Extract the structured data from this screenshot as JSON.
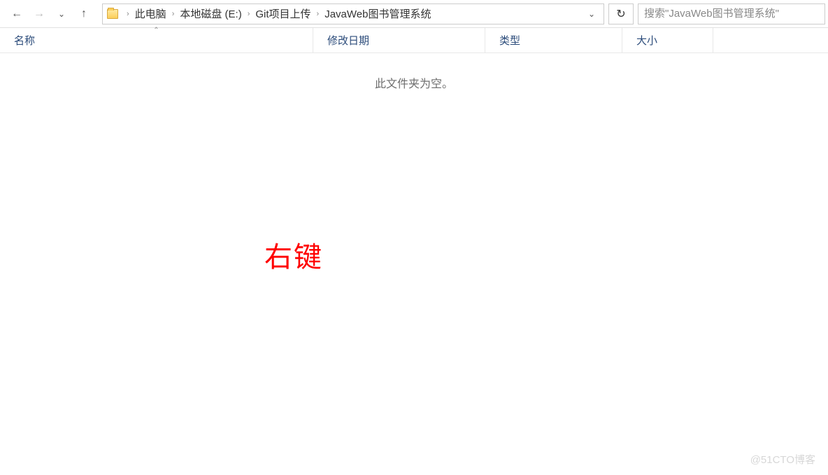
{
  "nav": {
    "back": "←",
    "forward": "→",
    "recent": "⌄",
    "up": "↑"
  },
  "breadcrumb": {
    "items": [
      "此电脑",
      "本地磁盘 (E:)",
      "Git项目上传",
      "JavaWeb图书管理系统"
    ],
    "separator": "›"
  },
  "refresh_glyph": "↻",
  "search": {
    "placeholder": "搜索\"JavaWeb图书管理系统\""
  },
  "columns": {
    "name": "名称",
    "date": "修改日期",
    "type": "类型",
    "size": "大小",
    "sort_glyph": "⌃"
  },
  "content": {
    "empty_message": "此文件夹为空。"
  },
  "annotation": "右键",
  "watermark": "@51CTO博客"
}
